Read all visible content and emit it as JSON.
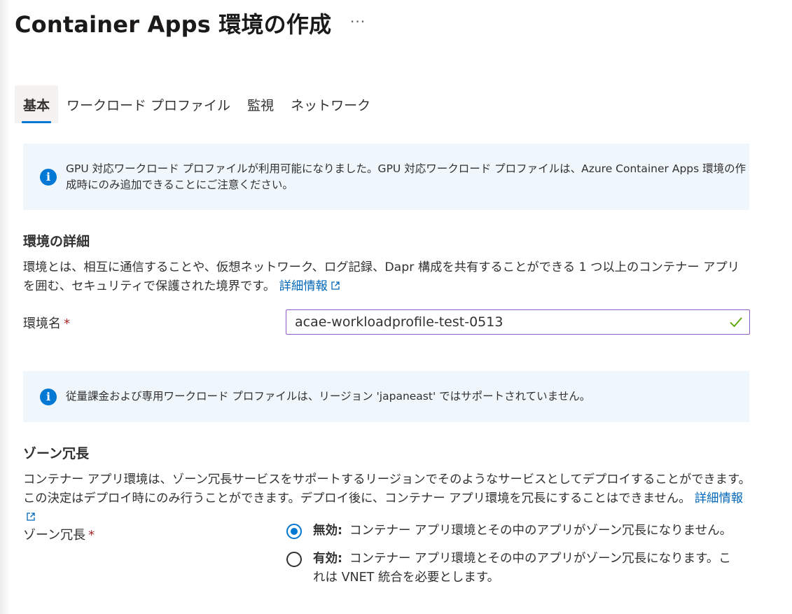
{
  "title": "Container Apps 環境の作成",
  "more_label": "···",
  "tabs": [
    {
      "label": "基本"
    },
    {
      "label": "ワークロード プロファイル"
    },
    {
      "label": "監視"
    },
    {
      "label": "ネットワーク"
    }
  ],
  "info_gpu": "GPU 対応ワークロード プロファイルが利用可能になりました。GPU 対応ワークロード プロファイルは、Azure Container Apps 環境の作成時にのみ追加できることにご注意ください。",
  "env_details": {
    "heading": "環境の詳細",
    "description": "環境とは、相互に通信することや、仮想ネットワーク、ログ記録、Dapr 構成を共有することができる 1 つ以上のコンテナー アプリを囲む、セキュリティで保護された境界です。",
    "learn_more": "詳細情報"
  },
  "env_name": {
    "label": "環境名",
    "required": "*",
    "value": "acae-workloadprofile-test-0513"
  },
  "info_region": "従量課金および専用ワークロード プロファイルは、リージョン 'japaneast' ではサポートされていません。",
  "zone": {
    "heading": "ゾーン冗長",
    "description": "コンテナー アプリ環境は、ゾーン冗長サービスをサポートするリージョンでそのようなサービスとしてデプロイすることができます。この決定はデプロイ時にのみ行うことができます。デプロイ後に、コンテナー アプリ環境を冗長にすることはできません。",
    "learn_more": "詳細情報",
    "label": "ゾーン冗長",
    "required": "*",
    "options": [
      {
        "title": "無効:",
        "text": "コンテナー アプリ環境とその中のアプリがゾーン冗長になりません。",
        "selected": true
      },
      {
        "title": "有効:",
        "text": "コンテナー アプリ環境とその中のアプリがゾーン冗長になります。これは VNET 統合を必要とします。",
        "selected": false
      }
    ]
  },
  "colors": {
    "accent": "#0078d4",
    "info_bg": "#eff6fc",
    "required": "#a4262c",
    "success": "#57a300",
    "link": "#0067b8"
  },
  "icons": [
    "info-icon",
    "external-link-icon",
    "checkmark-icon",
    "more-icon"
  ]
}
